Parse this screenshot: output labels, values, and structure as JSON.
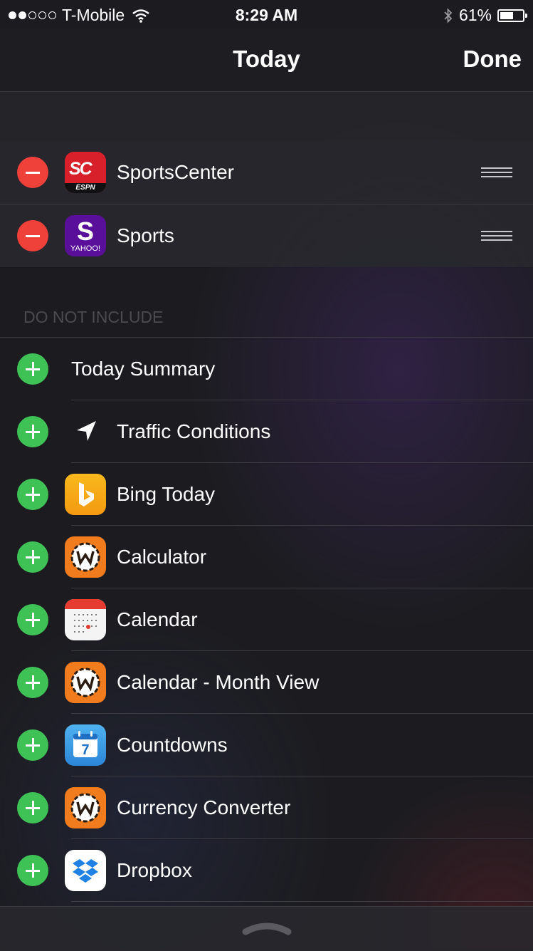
{
  "status_bar": {
    "carrier": "T-Mobile",
    "time": "8:29 AM",
    "battery": "61%",
    "battery_level": 0.61
  },
  "nav": {
    "title": "Today",
    "done_label": "Done"
  },
  "included": [
    {
      "label": "SportsCenter",
      "icon": "sportscenter-app-icon",
      "icon_text": "SC",
      "icon_sub": "ESPN"
    },
    {
      "label": "Sports",
      "icon": "yahoo-sports-app-icon",
      "icon_text": "S",
      "icon_sub": "YAHOO!"
    }
  ],
  "section_header": "DO NOT INCLUDE",
  "excluded": [
    {
      "label": "Today Summary",
      "icon": ""
    },
    {
      "label": "Traffic Conditions",
      "icon": "location-arrow-icon"
    },
    {
      "label": "Bing Today",
      "icon": "bing-app-icon"
    },
    {
      "label": "Calculator",
      "icon": "wunderground-gear-icon"
    },
    {
      "label": "Calendar",
      "icon": "calendar-app-icon"
    },
    {
      "label": "Calendar - Month View",
      "icon": "wunderground-gear-icon"
    },
    {
      "label": "Countdowns",
      "icon": "countdowns-app-icon",
      "icon_text": "7"
    },
    {
      "label": "Currency Converter",
      "icon": "wunderground-gear-icon"
    },
    {
      "label": "Dropbox",
      "icon": "dropbox-app-icon"
    }
  ],
  "colors": {
    "remove": "#f0403a",
    "add": "#3fc255",
    "background": "#1c1c20"
  }
}
